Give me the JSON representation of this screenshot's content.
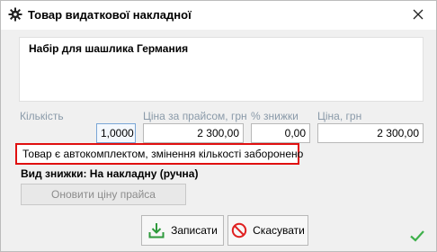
{
  "window": {
    "title": "Товар видаткової накладної",
    "colors": {
      "alert_border": "#e01010",
      "check": "#3db04a",
      "save_icon": "#2e9a3c",
      "cancel_icon": "#e02020"
    }
  },
  "product": {
    "name": "Набір для шашлика Германия"
  },
  "fields": {
    "quantity": {
      "label": "Кількість",
      "value": "1,0000"
    },
    "price_list": {
      "label": "Ціна за прайсом, грн",
      "value": "2 300,00"
    },
    "discount_pct": {
      "label": "% знижки",
      "value": "0,00"
    },
    "price": {
      "label": "Ціна, грн",
      "value": "2 300,00"
    }
  },
  "alert": {
    "text": "Товар є автокомплектом, змінення кількості заборонено"
  },
  "discount_type": {
    "text": "Вид знижки: На накладну (ручна)"
  },
  "buttons": {
    "refresh_price": "Оновити ціну прайса",
    "save": "Записати",
    "cancel": "Скасувати"
  },
  "icons": {
    "title": "gear-icon",
    "close": "close-icon",
    "save": "download-icon",
    "cancel": "no-entry-icon",
    "status": "checkmark-icon"
  }
}
